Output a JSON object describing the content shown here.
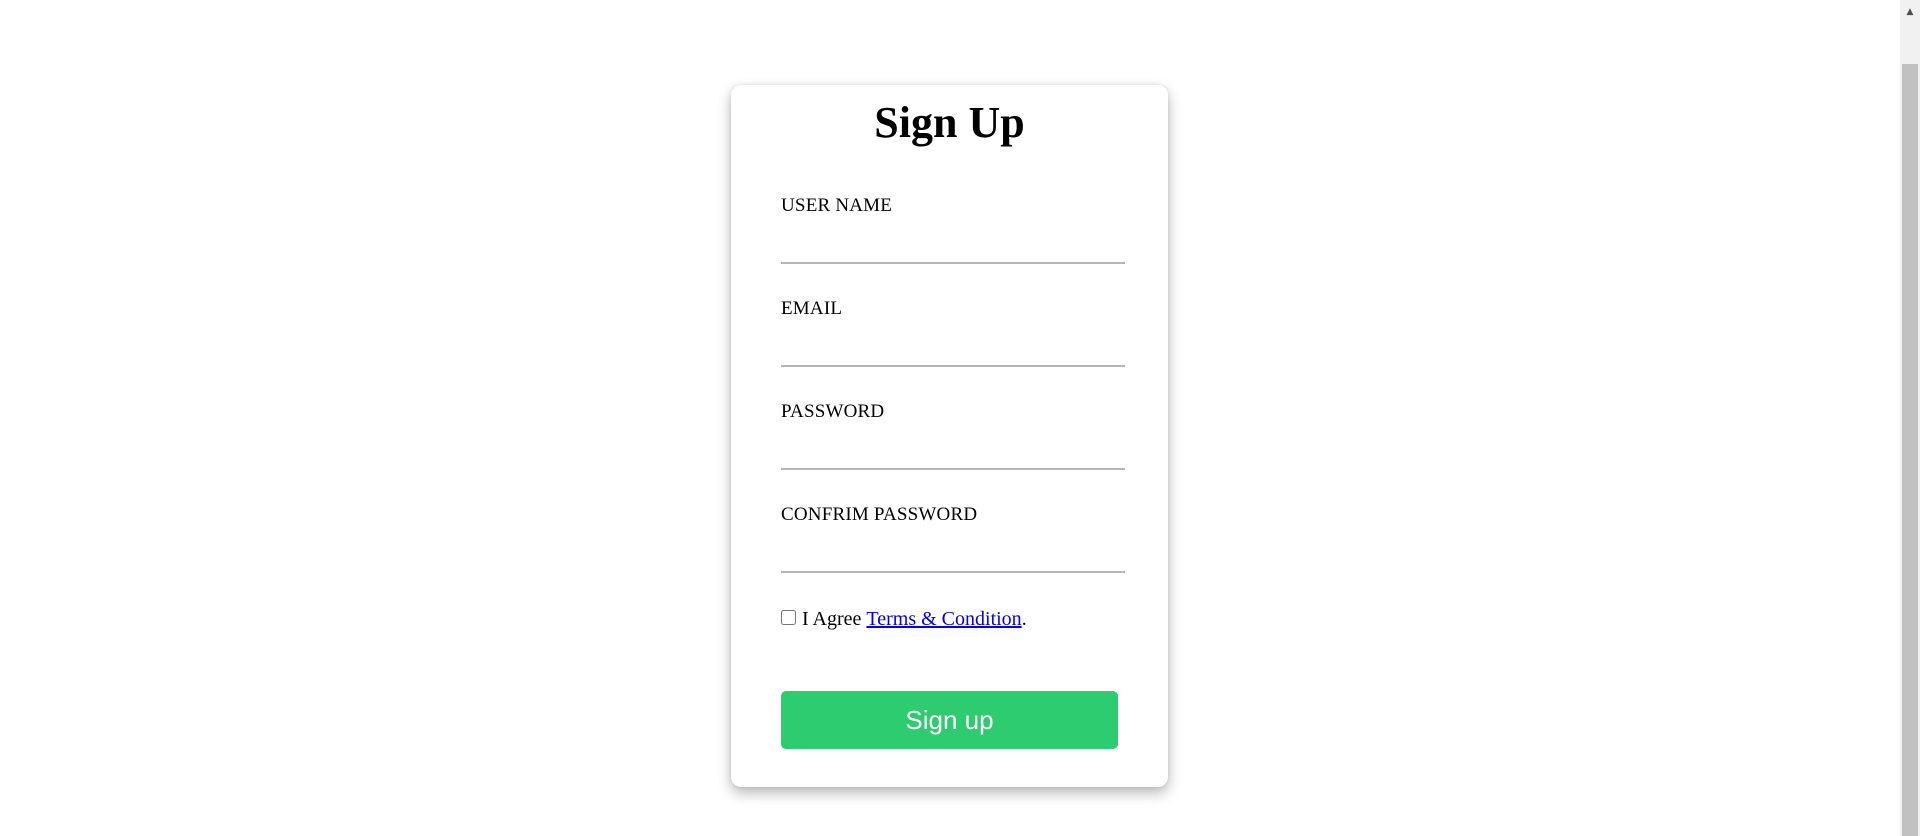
{
  "form": {
    "title": "Sign Up",
    "fields": [
      {
        "label": "USER NAME",
        "value": "",
        "type": "text"
      },
      {
        "label": "EMAIL",
        "value": "",
        "type": "email"
      },
      {
        "label": "PASSWORD",
        "value": "",
        "type": "password"
      },
      {
        "label": "CONFRIM PASSWORD",
        "value": "",
        "type": "password"
      }
    ],
    "agree": {
      "prefix": "I Agree",
      "link": "Terms & Condition",
      "suffix": ".",
      "checked": false
    },
    "submit_label": "Sign up"
  },
  "scrollbar": {
    "up_arrow": "up-arrow-icon"
  },
  "colors": {
    "button": "#2ecc71",
    "link": "#0000ee",
    "underline": "#b5b5b5"
  }
}
